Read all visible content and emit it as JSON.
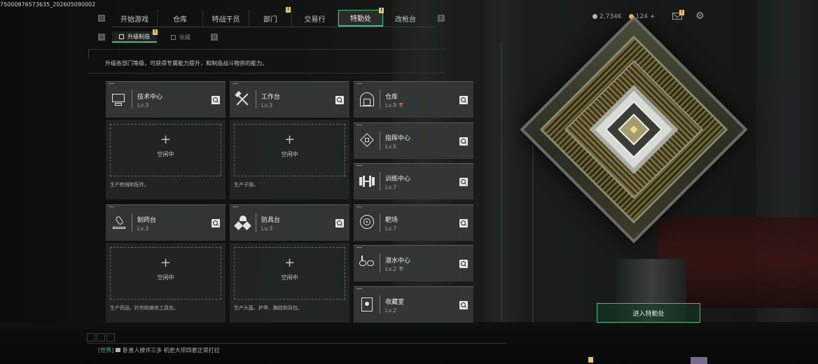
{
  "watermark": "75000876573635_202605090002",
  "nav": {
    "tabs": [
      {
        "label": "开始游戏",
        "badge": false
      },
      {
        "label": "仓库",
        "badge": false
      },
      {
        "label": "特战干员",
        "badge": false
      },
      {
        "label": "部门",
        "badge": true
      },
      {
        "label": "交易行",
        "badge": false
      },
      {
        "label": "特勤处",
        "badge": true,
        "active": true
      },
      {
        "label": "改枪台",
        "badge": false
      }
    ],
    "left_key": "Q",
    "right_key": "E"
  },
  "currency": {
    "silver": "2,734K",
    "gold": "124",
    "add": "+"
  },
  "subtabs": {
    "left_key": "A",
    "right_key": "D",
    "items": [
      {
        "label": "升级制造",
        "active": true,
        "badge": true
      },
      {
        "label": "收藏",
        "active": false,
        "badge": false
      }
    ]
  },
  "description": "升级各部门等级，可获得专属能力提升，和制造战斗物资的能力。",
  "workbenches": [
    {
      "name": "技术中心",
      "level": "Lv.3",
      "icon": "tech-center-icon",
      "status": "空闲中",
      "note": "生产枪械和配件。"
    },
    {
      "name": "工作台",
      "level": "Lv.3",
      "icon": "workbench-icon",
      "status": "空闲中",
      "note": "生产子弹。"
    },
    {
      "name": "制药台",
      "level": "Lv.3",
      "icon": "pharmacy-icon",
      "status": "空闲中",
      "note": "生产药品、针剂和维修工具包。"
    },
    {
      "name": "防具台",
      "level": "Lv.3",
      "icon": "armor-bench-icon",
      "status": "空闲中",
      "note": "生产头盔、护甲、胸挂和背包。"
    }
  ],
  "departments": [
    {
      "name": "仓库",
      "level": "Lv.9",
      "upgrade": true,
      "icon": "warehouse-icon"
    },
    {
      "name": "指挥中心",
      "level": "Lv.6",
      "upgrade": false,
      "icon": "command-center-icon"
    },
    {
      "name": "训练中心",
      "level": "Lv.7",
      "upgrade": false,
      "icon": "training-center-icon"
    },
    {
      "name": "靶场",
      "level": "Lv.7",
      "upgrade": false,
      "icon": "shooting-range-icon"
    },
    {
      "name": "潜水中心",
      "level": "Lv.2",
      "upgrade": true,
      "icon": "diving-center-icon"
    },
    {
      "name": "收藏室",
      "level": "Lv.2",
      "upgrade": false,
      "icon": "collection-room-icon"
    }
  ],
  "enter_button": "进入特勤处",
  "chat": {
    "channel": "[世界]",
    "message": "卧直人撩许三多  机密大坝四套正常打拉"
  },
  "colors": {
    "accent": "#3fbf7f",
    "badge": "#e5c46a",
    "card_bg": "#343836"
  }
}
